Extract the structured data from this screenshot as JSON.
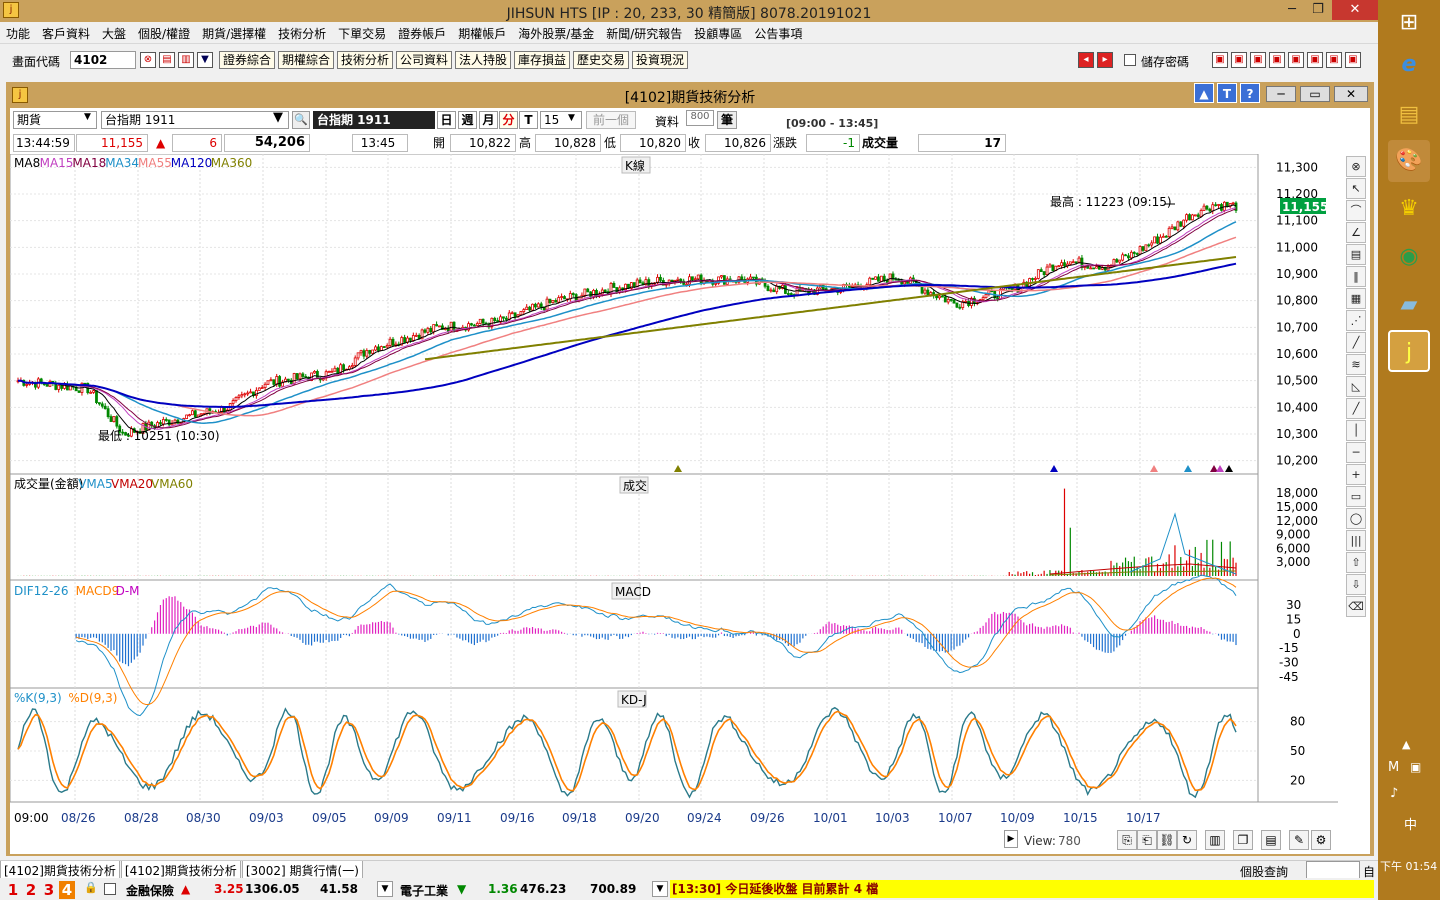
{
  "app": {
    "title": "JIHSUN HTS     [IP : 20, 233, 30 精簡版] 8078.20191021"
  },
  "menu": [
    "功能",
    "客戶資料",
    "大盤",
    "個股/權證",
    "期貨/選擇權",
    "技術分析",
    "下單交易",
    "證券帳戶",
    "期權帳戶",
    "海外股票/基金",
    "新聞/研究報告",
    "投顧專區",
    "公告事項"
  ],
  "toolbar": {
    "code_label": "畫面代碼",
    "code_value": "4102",
    "buttons": [
      "證券綜合",
      "期權綜合",
      "技術分析",
      "公司資料",
      "法人持股",
      "庫存損益",
      "歷史交易",
      "投資現況"
    ],
    "save_pwd": "儲存密碼"
  },
  "window": {
    "title": "[4102]期貨技術分析"
  },
  "controls": {
    "type": "期貨",
    "symbol": "台指期 1911",
    "symbol_display": "台指期 1911",
    "periods": [
      "日",
      "週",
      "月",
      "分",
      "T"
    ],
    "interval": "15",
    "prev": "前一個",
    "data_label": "資料",
    "data_count": "800",
    "unit": "筆",
    "session": "[09:00 - 13:45]"
  },
  "quote": {
    "time": "13:44:59",
    "price": "11,155",
    "change": "6",
    "volume_total": "54,206",
    "bar_time": "13:45",
    "open_label": "開",
    "open": "10,822",
    "high_label": "高",
    "high": "10,828",
    "low_label": "低",
    "low": "10,820",
    "close_label": "收",
    "close": "10,826",
    "chg_label": "漲跌",
    "chg": "-1",
    "vol_label": "成交量",
    "vol": "17"
  },
  "legends": {
    "k": {
      "items": [
        {
          "t": "MA8",
          "c": "#000000"
        },
        {
          "t": "MA15",
          "c": "#c040c0"
        },
        {
          "t": "MA18",
          "c": "#800040"
        },
        {
          "t": "MA34",
          "c": "#1e90c8"
        },
        {
          "t": "MA55",
          "c": "#f08080"
        },
        {
          "t": "MA120",
          "c": "#0000c0"
        },
        {
          "t": "MA360",
          "c": "#808000"
        }
      ],
      "tag": "K線"
    },
    "vol": {
      "items": [
        {
          "t": "成交量(金額)",
          "c": "#000000"
        },
        {
          "t": "VMA5",
          "c": "#1e90c8"
        },
        {
          "t": "VMA20",
          "c": "#c00000"
        },
        {
          "t": "VMA60",
          "c": "#808000"
        }
      ],
      "tag": "成交"
    },
    "macd": {
      "items": [
        {
          "t": "DIF12-26",
          "c": "#1e90c8"
        },
        {
          "t": "MACD9",
          "c": "#ff8000"
        },
        {
          "t": "D-M",
          "c": "#c000c0"
        }
      ],
      "tag": "MACD"
    },
    "kd": {
      "items": [
        {
          "t": "%K(9,3)",
          "c": "#1e90c8"
        },
        {
          "t": "%D(9,3)",
          "c": "#ff8000"
        }
      ],
      "tag": "KD-J"
    }
  },
  "annotations": {
    "high": "最高 : 11223 (09:15)",
    "low": "最低 : 10251 (10:30)",
    "last_price": "11,155"
  },
  "axes": {
    "k_ticks": [
      "11,300",
      "11,200",
      "11,100",
      "11,000",
      "10,900",
      "10,800",
      "10,700",
      "10,600",
      "10,500",
      "10,400",
      "10,300",
      "10,200"
    ],
    "vol_ticks": [
      "18,000",
      "15,000",
      "12,000",
      "9,000",
      "6,000",
      "3,000"
    ],
    "macd_ticks": [
      "30",
      "15",
      "0",
      "-15",
      "-30",
      "-45"
    ],
    "kd_ticks": [
      "80",
      "50",
      "20"
    ],
    "x_ticks": [
      "09:00",
      "08/26",
      "08/28",
      "08/30",
      "09/03",
      "09/05",
      "09/09",
      "09/11",
      "09/16",
      "09/18",
      "09/20",
      "09/24",
      "09/26",
      "10/01",
      "10/03",
      "10/07",
      "10/09",
      "10/15",
      "10/17"
    ]
  },
  "chart_data": {
    "type": "candlestick",
    "title": "[4102]期貨技術分析",
    "price_range": [
      10150,
      11350
    ],
    "high": 11223,
    "low": 10251,
    "last": 11155,
    "price_path": [
      [
        0,
        10500
      ],
      [
        6,
        10470
      ],
      [
        9,
        10300
      ],
      [
        12,
        10340
      ],
      [
        18,
        10400
      ],
      [
        21,
        10490
      ],
      [
        27,
        10530
      ],
      [
        30,
        10620
      ],
      [
        36,
        10700
      ],
      [
        41,
        10720
      ],
      [
        46,
        10800
      ],
      [
        51,
        10850
      ],
      [
        56,
        10880
      ],
      [
        62,
        10880
      ],
      [
        66,
        10830
      ],
      [
        71,
        10850
      ],
      [
        75,
        10890
      ],
      [
        80,
        10790
      ],
      [
        85,
        10840
      ],
      [
        89,
        10950
      ],
      [
        93,
        10930
      ],
      [
        95,
        10970
      ],
      [
        98,
        11050
      ],
      [
        100,
        11120
      ],
      [
        102,
        11160
      ],
      [
        104,
        11155
      ]
    ]
  },
  "bottom": {
    "view_label": "View:",
    "view_value": "780"
  },
  "tabs": [
    "[4102]期貨技術分析",
    "[4102]期貨技術分析",
    "[3002]  期貨行情(一)"
  ],
  "ticker": {
    "nums": [
      "1",
      "2",
      "3",
      "4"
    ],
    "item1_name": "金融保險",
    "item1_chg": "3.25",
    "item1_val": "1306.05",
    "item1_val2": "41.58",
    "item2_name": "電子工業",
    "item2_chg": "1.36",
    "item2_val": "476.23",
    "item2_val2": "700.89",
    "news": "[13:30] 今日延後收盤 目前累計 4 檔",
    "query": "個股查詢",
    "query_btn": "自"
  },
  "taskbar": {
    "time": "下午 01:54",
    "ime": "中"
  }
}
